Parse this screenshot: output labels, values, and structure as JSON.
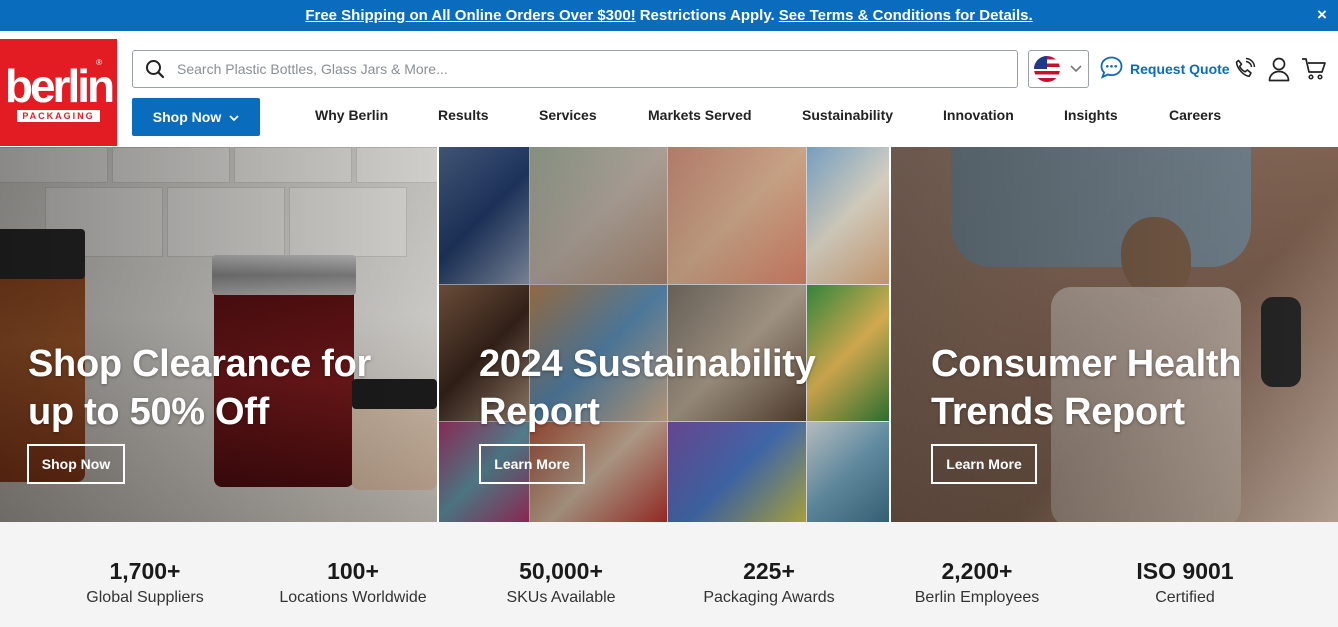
{
  "promo": {
    "link_text": "Free Shipping on All Online Orders Over $300!",
    "middle_text": "Restrictions Apply.",
    "terms_link": "See Terms & Conditions for Details.",
    "close": "×"
  },
  "brand": {
    "logo_word": "berlin",
    "logo_sub": "PACKAGING",
    "reg": "®"
  },
  "search": {
    "placeholder": "Search Plastic Bottles, Glass Jars & More..."
  },
  "header": {
    "request_quote": "Request Quote"
  },
  "nav": {
    "shop_now": "Shop Now",
    "items": [
      "Why Berlin",
      "Results",
      "Services",
      "Markets Served",
      "Sustainability",
      "Innovation",
      "Insights",
      "Careers"
    ]
  },
  "heroes": [
    {
      "title_line1": "Shop Clearance for",
      "title_line2": "up to 50% Off",
      "button": "Shop Now"
    },
    {
      "title_line1": "2024 Sustainability",
      "title_line2": "Report",
      "button": "Learn More"
    },
    {
      "title_line1": "Consumer Health",
      "title_line2": "Trends Report",
      "button": "Learn More"
    }
  ],
  "stats": [
    {
      "value": "1,700+",
      "label": "Global Suppliers"
    },
    {
      "value": "100+",
      "label": "Locations Worldwide"
    },
    {
      "value": "50,000+",
      "label": "SKUs Available"
    },
    {
      "value": "225+",
      "label": "Packaging Awards"
    },
    {
      "value": "2,200+",
      "label": "Berlin Employees"
    },
    {
      "value": "ISO 9001",
      "label": "Certified"
    }
  ],
  "colors": {
    "brand_blue": "#0a6cbc",
    "brand_red": "#e31b23",
    "stats_bg": "#f4f4f4"
  },
  "icons": [
    "close-icon",
    "search-icon",
    "us-flag-icon",
    "chevron-down-icon",
    "chat-bubble-icon",
    "phone-icon",
    "user-icon",
    "cart-icon"
  ]
}
